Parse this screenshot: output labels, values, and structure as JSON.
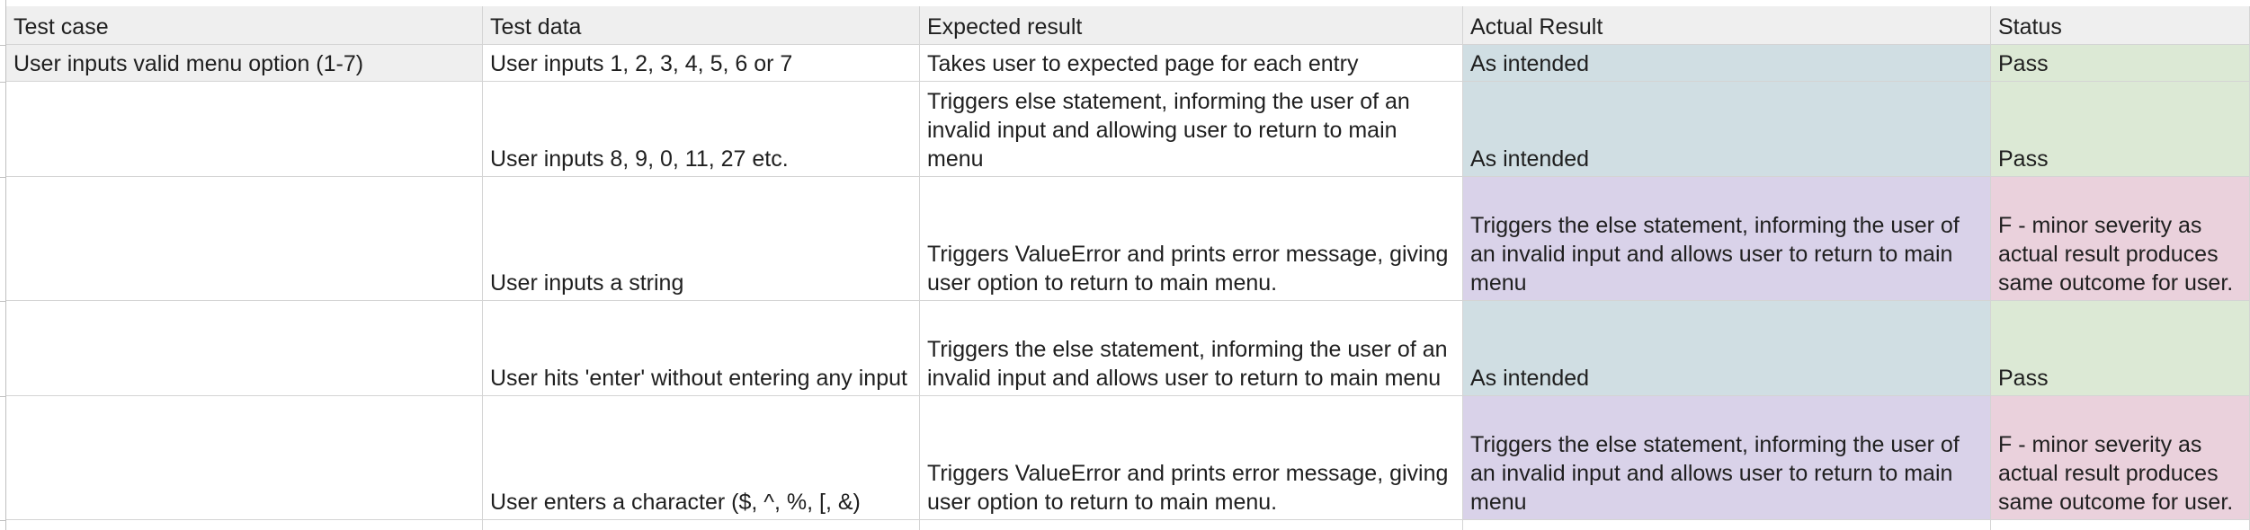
{
  "columns": [
    "Test case",
    "Test data",
    "Expected result",
    "Actual Result",
    "Status"
  ],
  "colors": {
    "header_bg": "#efefef",
    "actual_pass_bg": "#d0dee3",
    "status_pass_bg": "#dce9d5",
    "actual_fail_bg": "#d9d2e9",
    "status_fail_bg": "#ead1dc",
    "grid_line": "#d4d4d4"
  },
  "rows": [
    {
      "test_case": "User inputs valid menu option (1-7)",
      "test_data": "User inputs 1, 2, 3, 4, 5, 6 or 7",
      "expected": "Takes user to expected page for each entry",
      "actual": "As intended",
      "status": "Pass"
    },
    {
      "test_case": "",
      "test_data": "User inputs 8, 9, 0, 11, 27 etc.",
      "expected": "Triggers else statement, informing the user of an invalid input and allowing user to return to main menu",
      "actual": "As intended",
      "status": "Pass"
    },
    {
      "test_case": "",
      "test_data": "User inputs a string",
      "expected": "Triggers ValueError and prints error message, giving user option to return to main menu.",
      "actual": "Triggers the else statement, informing the user of an invalid input and allows user to return to main menu",
      "status": "F - minor severity as actual result produces same outcome for user."
    },
    {
      "test_case": "",
      "test_data": "User hits 'enter' without entering any input",
      "expected": "Triggers the else statement, informing the user of an invalid input and allows user to return to main menu",
      "actual": "As intended",
      "status": "Pass"
    },
    {
      "test_case": "",
      "test_data": "User enters a character ($, ^, %, [, &)",
      "expected": "Triggers ValueError and prints error message, giving user option to return to main menu.",
      "actual": "Triggers the else statement, informing the user of an invalid input and allows user to return to main menu",
      "status": "F - minor severity as actual result produces same outcome for user."
    }
  ]
}
